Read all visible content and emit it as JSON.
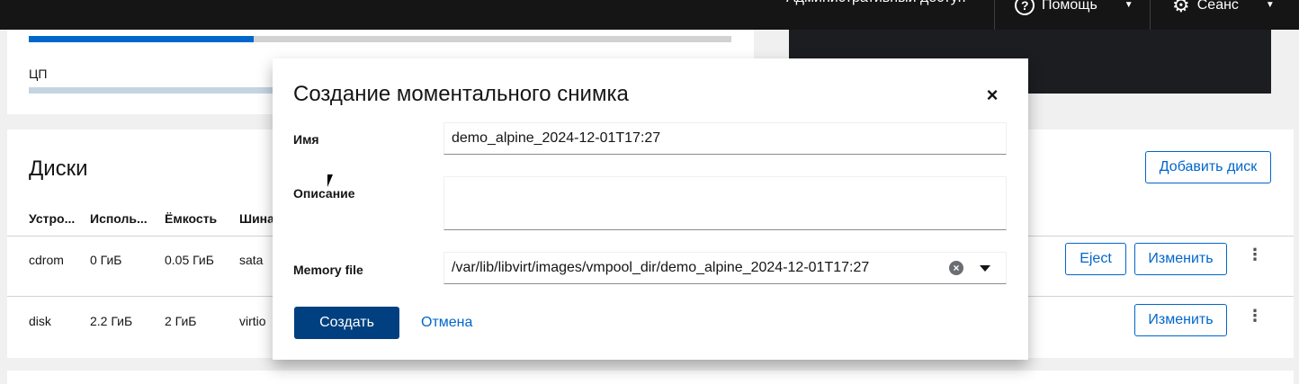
{
  "masthead": {
    "admin_access": "Административный доступ",
    "help": "Помощь",
    "session": "Сеанс"
  },
  "usage": {
    "cpu_label": "ЦП",
    "memory_fraction": 0.32
  },
  "disks": {
    "title": "Диски",
    "add_button": "Добавить диск",
    "columns": [
      "Устро...",
      "Исполь...",
      "Ёмкость",
      "Шина"
    ],
    "rows": [
      {
        "device": "cdrom",
        "used": "0 ГиБ",
        "capacity": "0.05 ГиБ",
        "bus": "sata",
        "eject": "Eject",
        "edit": "Изменить"
      },
      {
        "device": "disk",
        "used": "2.2 ГиБ",
        "capacity": "2 ГиБ",
        "bus": "virtio",
        "edit": "Изменить"
      }
    ]
  },
  "dialog": {
    "title": "Создание моментального снимка",
    "name_label": "Имя",
    "name_value": "demo_alpine_2024-12-01T17:27",
    "description_label": "Описание",
    "description_value": "",
    "memory_label": "Memory file",
    "memory_value": "/var/lib/libvirt/images/vmpool_dir/demo_alpine_2024-12-01T17:27",
    "create_button": "Создать",
    "cancel_button": "Отмена"
  }
}
